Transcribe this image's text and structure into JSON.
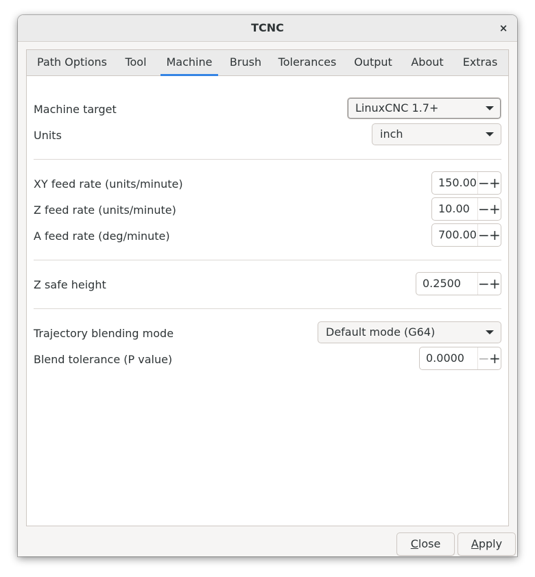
{
  "window": {
    "title": "TCNC",
    "close_glyph": "×"
  },
  "tabs": [
    {
      "label": "Path Options"
    },
    {
      "label": "Tool"
    },
    {
      "label": "Machine",
      "active": true
    },
    {
      "label": "Brush"
    },
    {
      "label": "Tolerances"
    },
    {
      "label": "Output"
    },
    {
      "label": "About"
    },
    {
      "label": "Extras"
    }
  ],
  "machine": {
    "target_label": "Machine target",
    "target_value": "LinuxCNC 1.7+",
    "units_label": "Units",
    "units_value": "inch",
    "xy_feed_label": "XY feed rate (units/minute)",
    "xy_feed_value": "150.00",
    "z_feed_label": "Z feed rate (units/minute)",
    "z_feed_value": "10.00",
    "a_feed_label": "A feed rate (deg/minute)",
    "a_feed_value": "700.00",
    "z_safe_label": "Z safe height",
    "z_safe_value": "0.2500",
    "blend_mode_label": "Trajectory blending mode",
    "blend_mode_value": "Default mode (G64)",
    "blend_tol_label": "Blend tolerance (P value)",
    "blend_tol_value": "0.0000"
  },
  "spin_glyphs": {
    "minus": "−",
    "plus": "+"
  },
  "buttons": {
    "close_mnemonic": "C",
    "close_rest": "lose",
    "apply_mnemonic": "A",
    "apply_rest": "pply"
  }
}
